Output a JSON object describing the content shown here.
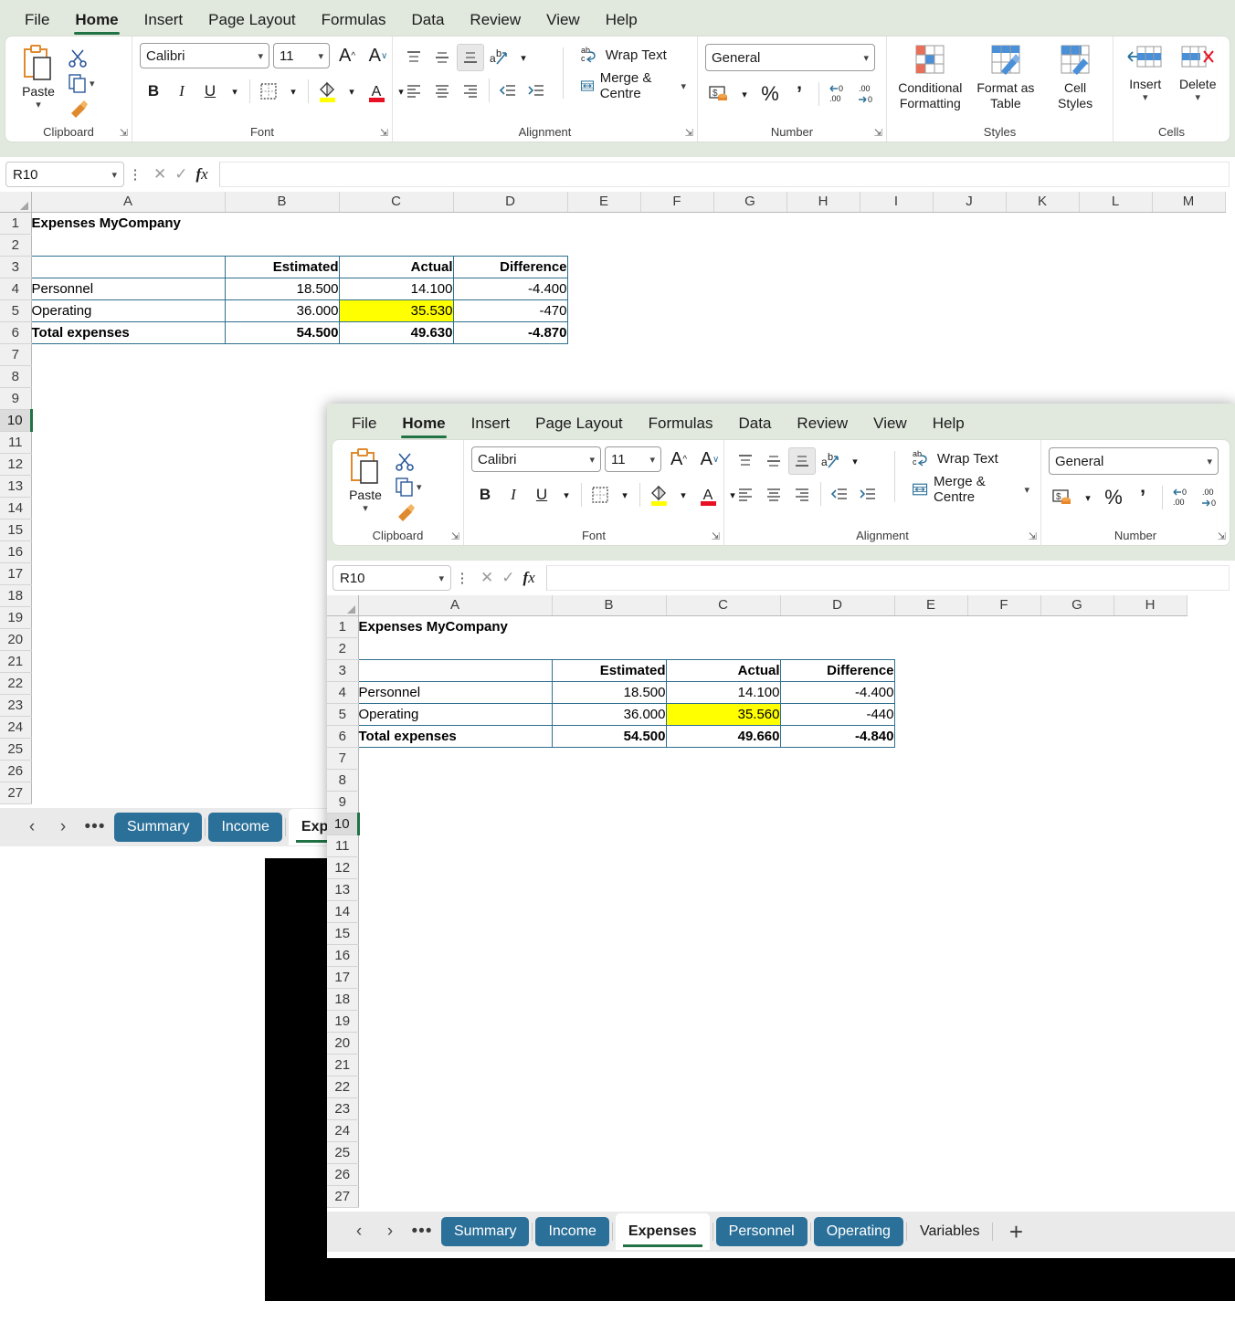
{
  "windows": {
    "background": {
      "ribbon_tabs": [
        "File",
        "Home",
        "Insert",
        "Page Layout",
        "Formulas",
        "Data",
        "Review",
        "View",
        "Help"
      ],
      "active_tab": "Home",
      "clipboard": {
        "group_label": "Clipboard",
        "paste_label": "Paste",
        "cut_icon": "scissors-icon",
        "copy_icon": "copy-icon",
        "format_painter_icon": "format-painter-icon"
      },
      "font": {
        "group_label": "Font",
        "family": "Calibri",
        "size": "11",
        "grow_label": "A",
        "shrink_label": "A",
        "bold": "B",
        "italic": "I",
        "underline": "U",
        "borders_icon": "borders-icon",
        "fill_icon": "fill-color-icon",
        "font_color_icon": "font-color-icon"
      },
      "alignment": {
        "group_label": "Alignment",
        "wrap_text": "Wrap Text",
        "merge_centre": "Merge & Centre",
        "orientation_icon": "orientation-icon"
      },
      "number": {
        "group_label": "Number",
        "format": "General",
        "accounting_icon": "accounting-format-icon",
        "percent": "%",
        "comma": "’",
        "decrease_decimal": "decrease-decimal-icon",
        "increase_decimal": "increase-decimal-icon"
      },
      "styles": {
        "group_label": "Styles",
        "conditional_formatting": "Conditional Formatting",
        "format_as_table": "Format as Table",
        "cell_styles": "Cell Styles"
      },
      "cells": {
        "group_label": "Cells",
        "insert": "Insert",
        "delete": "Delete"
      },
      "formula_bar": {
        "name_box": "R10",
        "formula": "",
        "cancel_icon": "cancel-icon",
        "enter_icon": "enter-icon",
        "fx_icon": "fx-icon"
      },
      "grid": {
        "columns": [
          "A",
          "B",
          "C",
          "D",
          "E",
          "F",
          "G",
          "H",
          "I",
          "J",
          "K",
          "L",
          "M"
        ],
        "rows": [
          1,
          2,
          3,
          4,
          5,
          6,
          7,
          8,
          9,
          10,
          11,
          12,
          13,
          14,
          15,
          16,
          17,
          18,
          19,
          20,
          21,
          22,
          23,
          24,
          25,
          26,
          27
        ],
        "selected_row": 10,
        "title_cell": "Expenses MyCompany",
        "table": {
          "headers": [
            "",
            "Estimated",
            "Actual",
            "Difference"
          ],
          "rows": [
            {
              "label": "Personnel",
              "estimated": "18.500",
              "actual": "14.100",
              "difference": "-4.400",
              "bold": false,
              "highlight": false
            },
            {
              "label": "Operating",
              "estimated": "36.000",
              "actual": "35.530",
              "difference": "-470",
              "bold": false,
              "highlight": true
            },
            {
              "label": "Total expenses",
              "estimated": "54.500",
              "actual": "49.630",
              "difference": "-4.870",
              "bold": true,
              "highlight": false
            }
          ]
        }
      },
      "sheet_tabs": {
        "prev_icon": "prev-sheet-icon",
        "next_icon": "next-sheet-icon",
        "more_icon": "more-sheets-icon",
        "tabs": [
          {
            "label": "Summary",
            "state": "selgroup"
          },
          {
            "label": "Income",
            "state": "selgroup"
          },
          {
            "label": "Expenses",
            "state": "active"
          }
        ]
      }
    },
    "foreground": {
      "ribbon_tabs": [
        "File",
        "Home",
        "Insert",
        "Page Layout",
        "Formulas",
        "Data",
        "Review",
        "View",
        "Help"
      ],
      "active_tab": "Home",
      "clipboard": {
        "group_label": "Clipboard",
        "paste_label": "Paste"
      },
      "font": {
        "group_label": "Font",
        "family": "Calibri",
        "size": "11",
        "bold": "B",
        "italic": "I",
        "underline": "U"
      },
      "alignment": {
        "group_label": "Alignment",
        "wrap_text": "Wrap Text",
        "merge_centre": "Merge & Centre"
      },
      "number": {
        "group_label": "Number",
        "format": "General",
        "percent": "%",
        "comma": "’"
      },
      "formula_bar": {
        "name_box": "R10",
        "formula": ""
      },
      "grid": {
        "columns": [
          "A",
          "B",
          "C",
          "D",
          "E",
          "F",
          "G",
          "H"
        ],
        "rows": [
          1,
          2,
          3,
          4,
          5,
          6,
          7,
          8,
          9,
          10,
          11,
          12,
          13,
          14,
          15,
          16,
          17,
          18,
          19,
          20,
          21,
          22,
          23,
          24,
          25,
          26,
          27
        ],
        "selected_row": 10,
        "title_cell": "Expenses MyCompany",
        "table": {
          "headers": [
            "",
            "Estimated",
            "Actual",
            "Difference"
          ],
          "rows": [
            {
              "label": "Personnel",
              "estimated": "18.500",
              "actual": "14.100",
              "difference": "-4.400",
              "bold": false,
              "highlight": false
            },
            {
              "label": "Operating",
              "estimated": "36.000",
              "actual": "35.560",
              "difference": "-440",
              "bold": false,
              "highlight": true
            },
            {
              "label": "Total expenses",
              "estimated": "54.500",
              "actual": "49.660",
              "difference": "-4.840",
              "bold": true,
              "highlight": false
            }
          ]
        }
      },
      "sheet_tabs": {
        "prev_icon": "prev-sheet-icon",
        "next_icon": "next-sheet-icon",
        "more_icon": "more-sheets-icon",
        "add_label": "+",
        "tabs": [
          {
            "label": "Summary",
            "state": "selgroup"
          },
          {
            "label": "Income",
            "state": "selgroup"
          },
          {
            "label": "Expenses",
            "state": "active"
          },
          {
            "label": "Personnel",
            "state": "selgroup"
          },
          {
            "label": "Operating",
            "state": "selgroup"
          },
          {
            "label": "Variables",
            "state": "normal"
          }
        ]
      }
    }
  },
  "colors": {
    "ribbon_bg": "#e1e8dd",
    "accent_green": "#217346",
    "title_blue": "#1f4e79",
    "table_header_blue": "#daeaf2",
    "table_border": "#2e6f8e",
    "highlight_yellow": "#ffff00",
    "sheet_tab_selected": "#2b7099"
  }
}
